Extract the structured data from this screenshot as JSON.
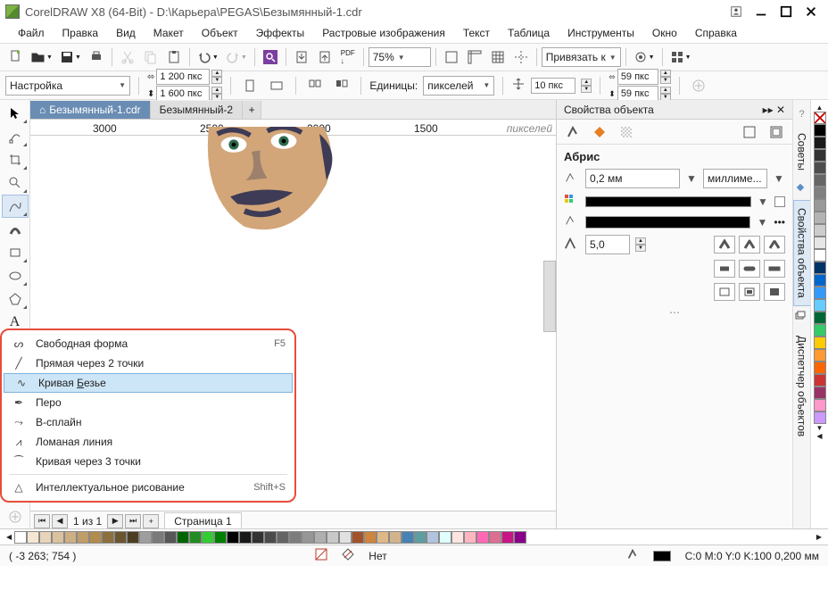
{
  "title": "CorelDRAW X8 (64-Bit) - D:\\Карьера\\PEGAS\\Безымянный-1.cdr",
  "menu": [
    "Файл",
    "Правка",
    "Вид",
    "Макет",
    "Объект",
    "Эффекты",
    "Растровые изображения",
    "Текст",
    "Таблица",
    "Инструменты",
    "Окно",
    "Справка"
  ],
  "zoom": "75%",
  "snap_label": "Привязать к",
  "prop_combo": "Настройка",
  "dims": {
    "w": "1 200 пкс",
    "h": "1 600 пкс"
  },
  "units_label": "Единицы:",
  "units_value": "пикселей",
  "nudge": "10 пкс",
  "dup": {
    "x": "59 пкс",
    "y": "59 пкс"
  },
  "doc_tabs": [
    "Безымянный-1.cdr",
    "Безымянный-2"
  ],
  "ruler_marks": [
    "3000",
    "2500",
    "2000",
    "1500"
  ],
  "ruler_units": "пикселей",
  "flyout": [
    {
      "label": "Свободная форма",
      "shortcut": "F5"
    },
    {
      "label": "Прямая через 2 точки",
      "shortcut": ""
    },
    {
      "label": "Кривая Безье",
      "shortcut": "",
      "hl": true
    },
    {
      "label": "Перо",
      "shortcut": ""
    },
    {
      "label": "В-сплайн",
      "shortcut": ""
    },
    {
      "label": "Ломаная линия",
      "shortcut": ""
    },
    {
      "label": "Кривая через 3 точки",
      "shortcut": ""
    },
    {
      "label": "Интеллектуальное рисование",
      "shortcut": "Shift+S",
      "sep_before": true
    }
  ],
  "flyout_letter": "Б",
  "docker": {
    "title": "Свойства объекта",
    "section": "Абрис",
    "width": "0,2 мм",
    "units": "миллиме...",
    "miter": "5,0"
  },
  "side_tabs": [
    "Советы",
    "Свойства объекта",
    "Диспетчер объектов"
  ],
  "page": {
    "nav": "1 из 1",
    "label": "Страница 1"
  },
  "status": {
    "coords": "( -3 263; 754 )",
    "fill": "Нет",
    "outline": "C:0 M:0 Y:0 K:100  0,200 мм"
  },
  "palette_colors": [
    "#000000",
    "#1a1a1a",
    "#333333",
    "#4d4d4d",
    "#666666",
    "#808080",
    "#999999",
    "#b3b3b3",
    "#cccccc",
    "#e6e6e6",
    "#ffffff",
    "#003366",
    "#0066cc",
    "#3399ff",
    "#66ccff",
    "#006633",
    "#33cc66",
    "#ffcc00",
    "#ff9933",
    "#ff6600",
    "#cc3333",
    "#993366",
    "#ff99cc",
    "#cc99ff"
  ],
  "hpalette": [
    "#f5e6d3",
    "#e8d4b8",
    "#dbc29e",
    "#cdaf83",
    "#c09d68",
    "#b38b4d",
    "#8b6f3d",
    "#6b5530",
    "#4d3d22",
    "#9e9e9e",
    "#7a7a7a",
    "#565656",
    "#006400",
    "#228b22",
    "#32cd32",
    "#008000",
    "#000000",
    "#191919",
    "#323232",
    "#4b4b4b",
    "#646464",
    "#7d7d7d",
    "#969696",
    "#afafaf",
    "#c8c8c8",
    "#e1e1e1",
    "#a0522d",
    "#cd853f",
    "#deb887",
    "#d2b48c",
    "#4682b4",
    "#5f9ea0",
    "#b0c4de",
    "#e0ffff",
    "#ffe4e1",
    "#ffb6c1",
    "#ff69b4",
    "#db7093",
    "#c71585",
    "#8b008b"
  ],
  "chart_data": null
}
